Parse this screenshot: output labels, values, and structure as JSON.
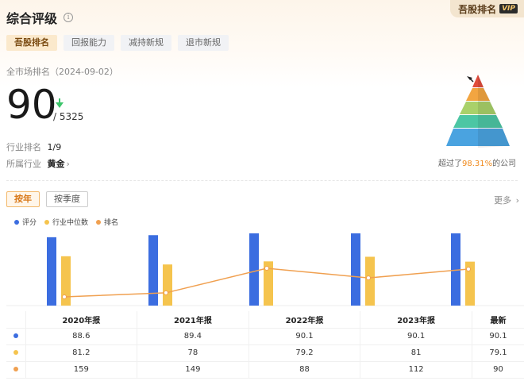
{
  "header": {
    "title": "综合评级",
    "info_icon": "i",
    "vip_label": "吾股排名",
    "vip_tag": "VIP"
  },
  "tabs": [
    {
      "label": "吾股排名",
      "active": true
    },
    {
      "label": "回报能力",
      "active": false
    },
    {
      "label": "减持新规",
      "active": false
    },
    {
      "label": "退市新规",
      "active": false
    }
  ],
  "summary": {
    "market_label": "全市场排名（2024-09-02）",
    "rank": "90",
    "total": "/ 5325",
    "trend_icon": "down-arrow-icon",
    "industry_rank_label": "行业排名",
    "industry_rank_value": "1/9",
    "industry_label": "所属行业",
    "industry_value": "黄金",
    "exceed_prefix": "超过了",
    "exceed_pct": "98.31%",
    "exceed_suffix": "的公司"
  },
  "period_tabs": [
    {
      "label": "按年",
      "active": true
    },
    {
      "label": "按季度",
      "active": false
    }
  ],
  "more_label": "更多",
  "legend": [
    {
      "label": "评分",
      "color": "#3b6de0"
    },
    {
      "label": "行业中位数",
      "color": "#f5c44e"
    },
    {
      "label": "排名",
      "color": "#f0a050"
    }
  ],
  "chart_data": {
    "type": "bar",
    "categories": [
      "2020年报",
      "2021年报",
      "2022年报",
      "2023年报",
      "最新"
    ],
    "series": [
      {
        "name": "评分",
        "type": "bar",
        "color": "#3b6de0",
        "values": [
          88.6,
          89.4,
          90.1,
          90.1,
          90.1
        ]
      },
      {
        "name": "行业中位数",
        "type": "bar",
        "color": "#f5c44e",
        "values": [
          81.2,
          78,
          79.2,
          81,
          79.1
        ]
      },
      {
        "name": "排名",
        "type": "line",
        "color": "#f0a050",
        "values": [
          159,
          149,
          88,
          112,
          90
        ]
      }
    ]
  },
  "table": {
    "headers": [
      "",
      "2020年报",
      "2021年报",
      "2022年报",
      "2023年报",
      "最新"
    ],
    "rows": [
      {
        "color": "#3b6de0",
        "cells": [
          "88.6",
          "89.4",
          "90.1",
          "90.1",
          "90.1"
        ]
      },
      {
        "color": "#f5c44e",
        "cells": [
          "81.2",
          "78",
          "79.2",
          "81",
          "79.1"
        ]
      },
      {
        "color": "#f0a050",
        "cells": [
          "159",
          "149",
          "88",
          "112",
          "90"
        ]
      }
    ]
  }
}
